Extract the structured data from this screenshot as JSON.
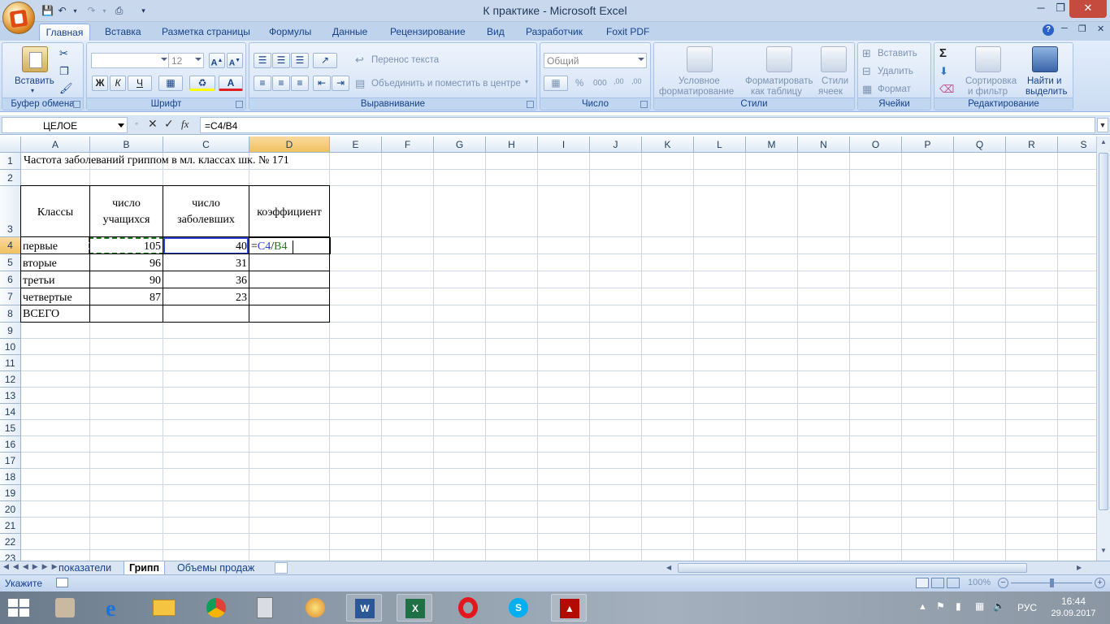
{
  "window": {
    "title": "К практике - Microsoft Excel"
  },
  "ribbon_tabs": [
    "Главная",
    "Вставка",
    "Разметка страницы",
    "Формулы",
    "Данные",
    "Рецензирование",
    "Вид",
    "Разработчик",
    "Foxit PDF"
  ],
  "clipboard": {
    "paste_label": "Вставить",
    "group_label": "Буфер обмена"
  },
  "font": {
    "font_name": "",
    "font_size": "12",
    "group_label": "Шрифт",
    "bold": "Ж",
    "italic": "К",
    "underline": "Ч"
  },
  "alignment": {
    "wrap_text": "Перенос текста",
    "merge_center": "Объединить и поместить в центре",
    "group_label": "Выравнивание"
  },
  "number": {
    "format": "Общий",
    "percent": "%",
    "thousands": "000",
    "group_label": "Число"
  },
  "styles": {
    "conditional": [
      "Условное",
      "форматирование"
    ],
    "table": [
      "Форматировать",
      "как таблицу"
    ],
    "cell": [
      "Стили",
      "ячеек"
    ],
    "group_label": "Стили"
  },
  "cells": {
    "insert": "Вставить",
    "delete": "Удалить",
    "format": "Формат",
    "group_label": "Ячейки"
  },
  "editing": {
    "sort": [
      "Сортировка",
      "и фильтр"
    ],
    "find": [
      "Найти и",
      "выделить"
    ],
    "group_label": "Редактирование"
  },
  "formula_bar": {
    "name_box": "ЦЕЛОЕ",
    "formula": "=C4/B4",
    "fx": "fx"
  },
  "columns": [
    "A",
    "B",
    "C",
    "D",
    "E",
    "F",
    "G",
    "H",
    "I",
    "J",
    "K",
    "L",
    "M",
    "N",
    "O",
    "P",
    "Q",
    "R",
    "S"
  ],
  "rows": [
    "1",
    "2",
    "3",
    "4",
    "5",
    "6",
    "7",
    "8",
    "9",
    "10",
    "11",
    "12",
    "13",
    "14",
    "15",
    "16",
    "17",
    "18",
    "19",
    "20",
    "21",
    "22",
    "23"
  ],
  "sheet": {
    "title": "Частота заболеваний гриппом в мл. классах шк. № 171",
    "headers": {
      "a": "Классы",
      "b1": "число",
      "b2": "учащихся",
      "c1": "число",
      "c2": "заболевших",
      "d": "коэффициент"
    },
    "data": [
      {
        "cls": "первые",
        "students": "105",
        "sick": "40"
      },
      {
        "cls": "вторые",
        "students": "96",
        "sick": "31"
      },
      {
        "cls": "третьи",
        "students": "90",
        "sick": "36"
      },
      {
        "cls": "четвертые",
        "students": "87",
        "sick": "23"
      }
    ],
    "total_label": "ВСЕГО",
    "editing_formula": {
      "eq": "=",
      "ref1": "C4",
      "slash": "/",
      "ref2": "B4"
    }
  },
  "sheet_tabs": [
    "показатели",
    "Грипп",
    "Объемы продаж"
  ],
  "status": {
    "mode": "Укажите",
    "zoom": "100%"
  },
  "taskbar": {
    "lang": "РУС",
    "time": "16:44",
    "date": "29.09.2017"
  },
  "colors": {
    "ref1": "#2b3fd1",
    "ref2": "#1d7a1d",
    "accent": "#15428b"
  }
}
